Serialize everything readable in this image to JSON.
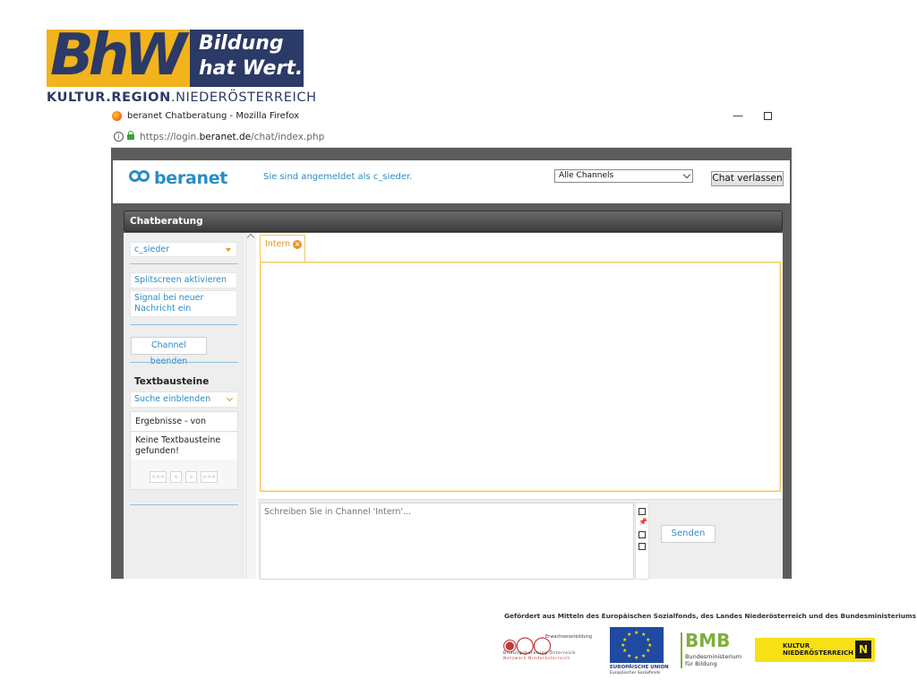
{
  "logo": {
    "bh": "BhW",
    "slogan_line1": "Bildung",
    "slogan_line2": "hat Wert.",
    "tagline_part1": "KULTUR",
    "tagline_part2": "REGION",
    "tagline_part3": "NIEDERÖSTERREICH",
    "tagline_sep": "."
  },
  "browser": {
    "window_title": "beranet Chatberatung - Mozilla Firefox",
    "url_prefix": "https://login.",
    "url_domain": "beranet.de",
    "url_path": "/chat/index.php",
    "minimize_glyph": "—",
    "info_glyph": "i"
  },
  "app": {
    "logo_text": "beranet",
    "logged_in_text": "Sie sind angemeldet als c_sieder.",
    "channel_select_value": "Alle Channels",
    "leave_button": "Chat verlassen",
    "chat_title": "Chatberatung"
  },
  "sidebar": {
    "user": "c_sieder",
    "splitscreen": "Splitscreen aktivieren",
    "signal": "Signal bei neuer Nachricht ein",
    "end_channel_button": "Channel beenden",
    "textbausteine_heading": "Textbausteine",
    "search_toggle": "Suche einblenden",
    "results_header": "Ergebnisse - von",
    "results_empty": "Keine Textbausteine gefunden!",
    "pager": [
      "<<<",
      "<",
      ">",
      ">>>"
    ]
  },
  "chat": {
    "tab_label": "Intern",
    "tab_close_glyph": "×",
    "compose_placeholder": "Schreiben Sie in Channel 'Intern'...",
    "send_button": "Senden",
    "tool_icons": [
      "note-icon",
      "pin-icon",
      "window-icon",
      "edit-icon"
    ]
  },
  "footer": {
    "funding_text": "Gefördert aus Mitteln des Europäischen Sozialfonds, des Landes Niederösterreich und des Bundesministeriums für Bildung.",
    "eb_top": "Erwachsenenbildung",
    "eb_line1": "Bildungsberatung Österreich",
    "eb_line2": "Netzwerk Niederösterreich",
    "eu_line1": "EUROPÄISCHE UNION",
    "eu_line2": "Europäischer Sozialfonds",
    "bmb": "BMB",
    "bmb_line1": "Bundesministerium",
    "bmb_line2": "für Bildung",
    "kr_line1": "KULTUR",
    "kr_line2": "NIEDERÖSTERREICH",
    "kr_mark": "N"
  },
  "colors": {
    "brand_blue": "#2a8dc5",
    "accent_orange": "#e59624",
    "bhw_yellow": "#f2b31c",
    "bhw_navy": "#2b3a66"
  }
}
